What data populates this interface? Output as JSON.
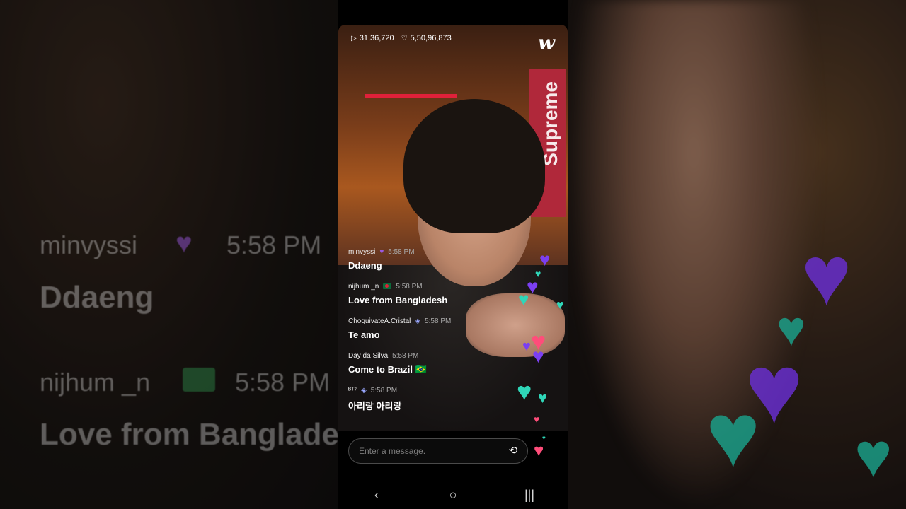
{
  "stats": {
    "plays": "31,36,720",
    "likes": "5,50,96,873",
    "play_icon": "play-icon",
    "heart_icon": "heart-outline-icon"
  },
  "brand": {
    "logo_text": "w"
  },
  "background": {
    "banner_text": "Supreme",
    "ghost_lines": [
      "minvyssi",
      "5:58 PM",
      "Ddaeng",
      "nijhum _n",
      "5:58 PM",
      "Love from Banglade"
    ]
  },
  "chat": [
    {
      "user": "minvyssi",
      "badge": "💜",
      "time": "5:58 PM",
      "text": "Ddaeng"
    },
    {
      "user": "nijhum _n",
      "badge": "🇧🇩",
      "time": "5:58 PM",
      "text": "Love from Bangladesh"
    },
    {
      "user": "ChoquivateA.Cristal",
      "badge": "🛡",
      "time": "5:58 PM",
      "text": "Te amo"
    },
    {
      "user": "Day da Silva",
      "badge": "",
      "time": "5:58 PM",
      "text": "Come to Brazil 🇧🇷"
    },
    {
      "user": "ᴮᵀ⁷",
      "badge": "🛡",
      "time": "5:58 PM",
      "text": "아리랑 아리랑"
    }
  ],
  "composer": {
    "placeholder": "Enter a message.",
    "camera_icon": "camera-flip-icon",
    "like_icon": "heart-icon"
  },
  "colors": {
    "heart_purple": "#7b3ff2",
    "heart_teal": "#2fd6b8",
    "heart_pink": "#ff4d7a",
    "banner_red": "#b0283a"
  },
  "navbar": {
    "back_icon": "back-icon",
    "home_icon": "home-icon",
    "recents_icon": "recents-icon"
  }
}
